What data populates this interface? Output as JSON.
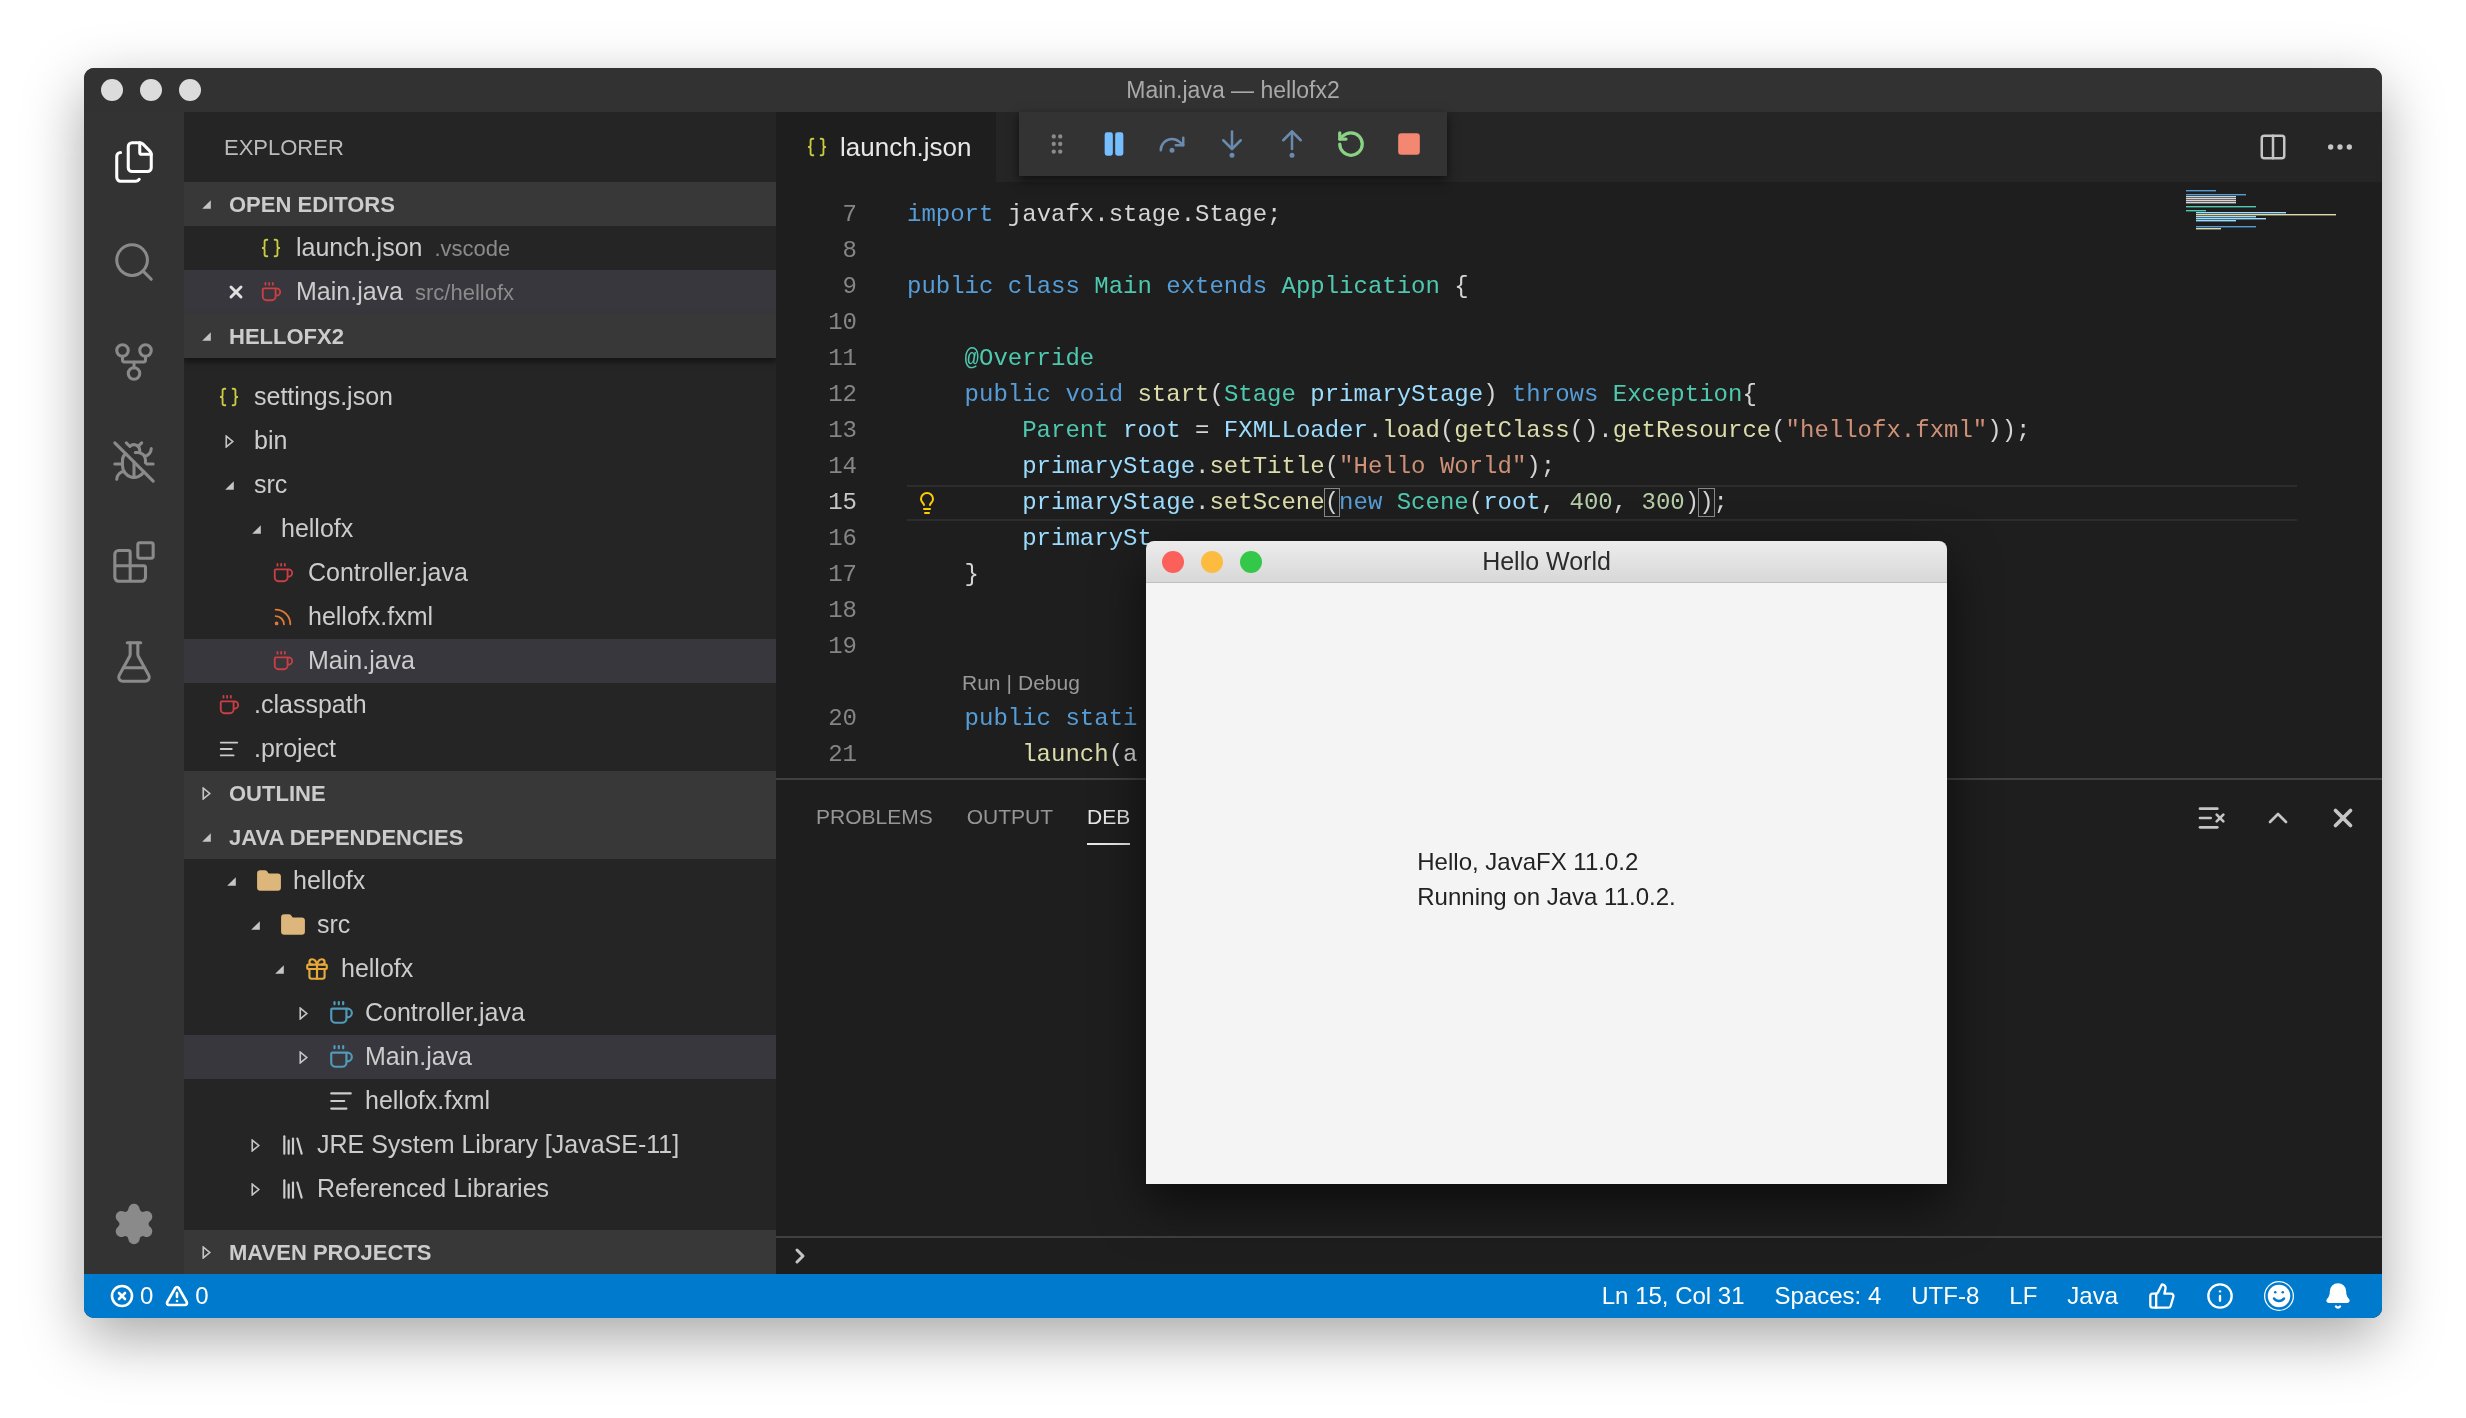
{
  "window": {
    "title": "Main.java — hellofx2"
  },
  "activity_bar": [
    {
      "selected": true
    },
    {
      "selected": false
    },
    {
      "selected": false
    },
    {
      "selected": false
    },
    {
      "selected": false
    },
    {
      "selected": false
    }
  ],
  "sidebar": {
    "title": "EXPLORER",
    "open_editors": {
      "title": "OPEN EDITORS",
      "expanded": true,
      "items": [
        {
          "name": "launch.json",
          "description": ".vscode",
          "kind": "json",
          "selected": false
        },
        {
          "name": "Main.java",
          "description": "src/hellofx",
          "kind": "java",
          "selected": true
        }
      ]
    },
    "folder": {
      "title": "HELLOFX2",
      "expanded": true,
      "items": [
        {
          "name": "settings.json",
          "kind": "json",
          "selected": false
        },
        {
          "name": "bin",
          "expanded": false,
          "selected": false
        },
        {
          "name": "src",
          "expanded": true,
          "selected": false,
          "children": [
            {
              "name": "hellofx",
              "expanded": true,
              "selected": false,
              "children": [
                {
                  "name": "Controller.java",
                  "kind": "java",
                  "selected": false
                },
                {
                  "name": "hellofx.fxml",
                  "kind": "xml",
                  "selected": false
                },
                {
                  "name": "Main.java",
                  "kind": "java",
                  "selected": true
                }
              ]
            }
          ]
        },
        {
          "name": ".classpath",
          "kind": "java",
          "selected": false
        },
        {
          "name": ".project",
          "kind": "text",
          "selected": false
        }
      ]
    },
    "outline": {
      "title": "OUTLINE",
      "expanded": false
    },
    "java_dependencies": {
      "title": "JAVA DEPENDENCIES",
      "expanded": true,
      "items": [
        {
          "name": "hellofx",
          "kind": "project",
          "expanded": true,
          "selected": false,
          "children": [
            {
              "name": "src",
              "kind": "package-root",
              "expanded": true,
              "selected": false,
              "children": [
                {
                  "name": "hellofx",
                  "kind": "package",
                  "expanded": true,
                  "selected": false,
                  "children": [
                    {
                      "name": "Controller.java",
                      "kind": "class",
                      "expanded": false,
                      "selected": false
                    },
                    {
                      "name": "Main.java",
                      "kind": "class",
                      "expanded": false,
                      "selected": true
                    },
                    {
                      "name": "hellofx.fxml",
                      "kind": "text",
                      "selected": false
                    }
                  ]
                }
              ]
            },
            {
              "name": "JRE System Library [JavaSE-11]",
              "kind": "library",
              "expanded": false,
              "selected": false
            },
            {
              "name": "Referenced Libraries",
              "kind": "library",
              "expanded": false,
              "selected": false
            }
          ]
        }
      ]
    },
    "maven_projects": {
      "title": "MAVEN PROJECTS",
      "expanded": false
    }
  },
  "editor": {
    "tabs": [
      {
        "label": "launch.json",
        "kind": "json",
        "selected": true
      }
    ],
    "lines": [
      {
        "kind": "code",
        "number": "7",
        "tokens": [
          {
            "kind": "keyword",
            "text": "import"
          },
          {
            "kind": "plain",
            "text": " javafx.stage.Stage;"
          }
        ]
      },
      {
        "kind": "code",
        "number": "8"
      },
      {
        "kind": "code",
        "number": "9",
        "tokens": [
          {
            "kind": "keyword",
            "text": "public"
          },
          {
            "kind": "keyword",
            "text": " class"
          },
          {
            "kind": "type",
            "text": " Main"
          },
          {
            "kind": "keyword",
            "text": " extends"
          },
          {
            "kind": "type",
            "text": " Application"
          },
          {
            "kind": "plain",
            "text": " {"
          }
        ]
      },
      {
        "kind": "code",
        "number": "10"
      },
      {
        "kind": "code",
        "number": "11",
        "tokens": [
          {
            "kind": "annotation",
            "text": "    @Override"
          }
        ]
      },
      {
        "kind": "code",
        "number": "12",
        "tokens": [
          {
            "kind": "keyword",
            "text": "    public"
          },
          {
            "kind": "keyword",
            "text": " void"
          },
          {
            "kind": "function",
            "text": " start"
          },
          {
            "kind": "plain",
            "text": "("
          },
          {
            "kind": "type",
            "text": "Stage"
          },
          {
            "kind": "variable",
            "text": " primaryStage"
          },
          {
            "kind": "plain",
            "text": ")"
          },
          {
            "kind": "keyword",
            "text": " throws"
          },
          {
            "kind": "type",
            "text": " Exception"
          },
          {
            "kind": "plain",
            "text": "{"
          }
        ]
      },
      {
        "kind": "code",
        "number": "13",
        "tokens": [
          {
            "kind": "type",
            "text": "        Parent"
          },
          {
            "kind": "variable",
            "text": " root"
          },
          {
            "kind": "plain",
            "text": " ="
          },
          {
            "kind": "variable",
            "text": " FXMLLoader"
          },
          {
            "kind": "plain",
            "text": "."
          },
          {
            "kind": "function",
            "text": "load"
          },
          {
            "kind": "plain",
            "text": "("
          },
          {
            "kind": "function",
            "text": "getClass"
          },
          {
            "kind": "plain",
            "text": "()."
          },
          {
            "kind": "function",
            "text": "getResource"
          },
          {
            "kind": "plain",
            "text": "("
          },
          {
            "kind": "string",
            "text": "\"hellofx.fxml\""
          },
          {
            "kind": "plain",
            "text": "));"
          }
        ]
      },
      {
        "kind": "code",
        "number": "14",
        "tokens": [
          {
            "kind": "variable",
            "text": "        primaryStage"
          },
          {
            "kind": "plain",
            "text": "."
          },
          {
            "kind": "function",
            "text": "setTitle"
          },
          {
            "kind": "plain",
            "text": "("
          },
          {
            "kind": "string",
            "text": "\"Hello World\""
          },
          {
            "kind": "plain",
            "text": ");"
          }
        ]
      },
      {
        "kind": "code",
        "number": "15",
        "current": true,
        "lightbulb": true,
        "tokens": [
          {
            "kind": "variable",
            "text": "        primaryStage"
          },
          {
            "kind": "plain",
            "text": "."
          },
          {
            "kind": "function",
            "text": "setScene"
          },
          {
            "kind": "bracket",
            "text": "("
          },
          {
            "kind": "keyword",
            "text": "new"
          },
          {
            "kind": "type",
            "text": " Scene"
          },
          {
            "kind": "plain",
            "text": "("
          },
          {
            "kind": "variable",
            "text": "root"
          },
          {
            "kind": "plain",
            "text": ","
          },
          {
            "kind": "number",
            "text": " 400"
          },
          {
            "kind": "plain",
            "text": ","
          },
          {
            "kind": "number",
            "text": " 300"
          },
          {
            "kind": "plain",
            "text": ")"
          },
          {
            "kind": "bracket",
            "text": ")"
          },
          {
            "kind": "plain",
            "text": ";"
          }
        ]
      },
      {
        "kind": "code",
        "number": "16",
        "tokens": [
          {
            "kind": "variable",
            "text": "        primarySt"
          }
        ]
      },
      {
        "kind": "code",
        "number": "17",
        "tokens": [
          {
            "kind": "plain",
            "text": "    }"
          }
        ]
      },
      {
        "kind": "code",
        "number": "18"
      },
      {
        "kind": "code",
        "number": "19"
      },
      {
        "kind": "codelens",
        "links": [
          "Run",
          "Debug"
        ],
        "separator": "|"
      },
      {
        "kind": "code",
        "number": "20",
        "tokens": [
          {
            "kind": "keyword",
            "text": "    public"
          },
          {
            "kind": "keyword",
            "text": " stati"
          }
        ]
      },
      {
        "kind": "code",
        "number": "21",
        "tokens": [
          {
            "kind": "function",
            "text": "        launch"
          },
          {
            "kind": "plain",
            "text": "(a"
          }
        ]
      }
    ]
  },
  "panel": {
    "tabs": [
      {
        "label": "PROBLEMS",
        "selected": false
      },
      {
        "label": "OUTPUT",
        "selected": false
      },
      {
        "label": "DEB",
        "selected": true
      }
    ]
  },
  "status_bar": {
    "errors": "0",
    "warnings": "0",
    "items": [
      "Ln 15, Col 31",
      "Spaces: 4",
      "UTF-8",
      "LF",
      "Java"
    ]
  },
  "dialog": {
    "title": "Hello World",
    "lines": [
      "Hello, JavaFX 11.0.2",
      "Running on Java 11.0.2."
    ]
  }
}
